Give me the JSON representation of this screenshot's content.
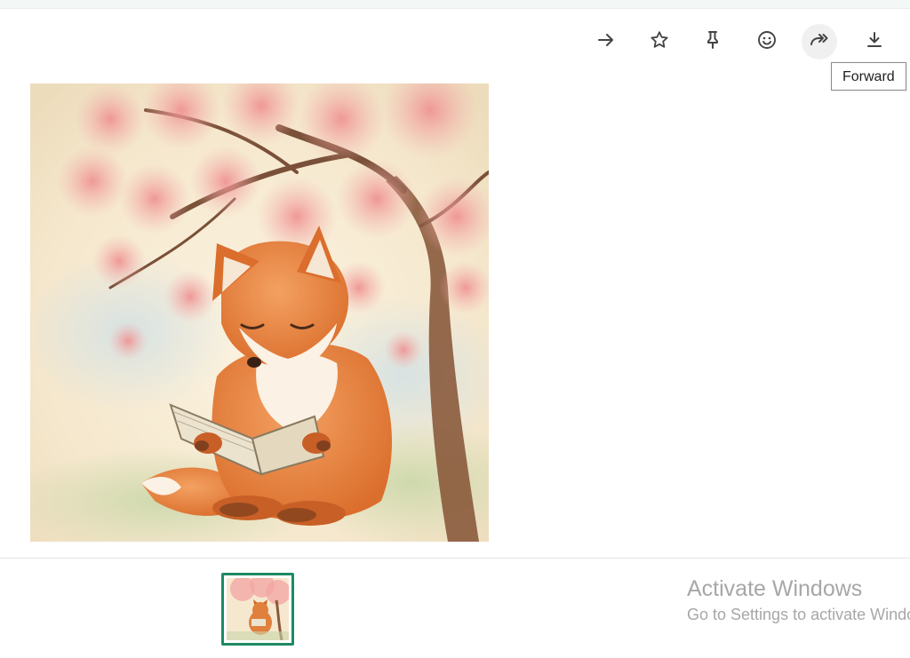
{
  "toolbar": {
    "buttons": [
      {
        "name": "forward-arrow",
        "icon": "arrow-right-icon"
      },
      {
        "name": "star",
        "icon": "star-icon"
      },
      {
        "name": "pin",
        "icon": "pin-icon"
      },
      {
        "name": "emoji",
        "icon": "smiley-icon"
      },
      {
        "name": "forward",
        "icon": "forward-icon"
      },
      {
        "name": "download",
        "icon": "download-icon"
      }
    ],
    "tooltip": "Forward"
  },
  "image": {
    "description_icon": "fox-reading-book-illustration"
  },
  "thumbnails": {
    "selected_index": 0,
    "accent_color": "#1e8a63"
  },
  "watermark": {
    "title": "Activate Windows",
    "subtitle": "Go to Settings to activate Windows."
  }
}
